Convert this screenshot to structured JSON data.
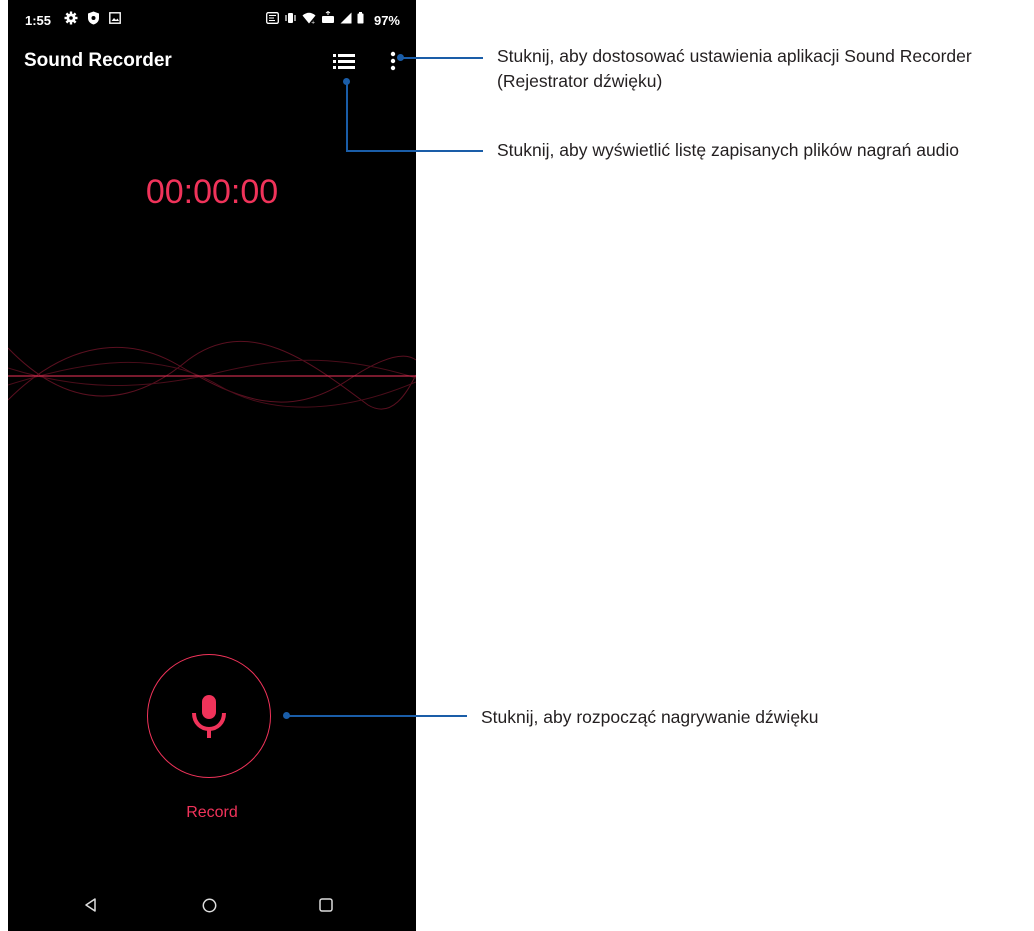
{
  "status_bar": {
    "time": "1:55",
    "battery": "97%",
    "left_icons": [
      "settings-icon",
      "shield-icon",
      "image-icon"
    ],
    "right_icons": [
      "nfc-icon",
      "vibrate-icon",
      "wifi-icon",
      "data-icon",
      "signal-icon",
      "battery-icon"
    ]
  },
  "app": {
    "title": "Sound Recorder",
    "timer": "00:00:00",
    "record_label": "Record"
  },
  "nav": {
    "icons": [
      "back-icon",
      "home-icon",
      "recents-icon"
    ]
  },
  "callouts": {
    "settings": "Stuknij, aby dostosować ustawienia aplikacji Sound Recorder (Rejestrator dźwięku)",
    "list": "Stuknij, aby wyświetlić listę zapisanych plików nagrań audio",
    "record": "Stuknij, aby rozpocząć nagrywanie dźwięku"
  },
  "colors": {
    "accent": "#f0335a",
    "callout": "#1a5da8",
    "background": "#000000"
  }
}
